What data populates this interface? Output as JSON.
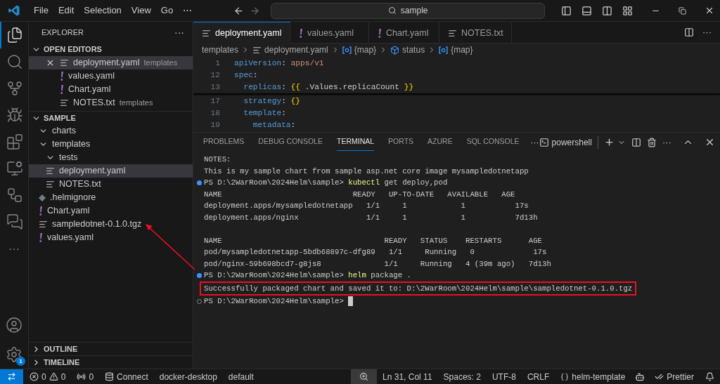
{
  "title_bar": {
    "menu": [
      "File",
      "Edit",
      "Selection",
      "View",
      "Go",
      "⋯"
    ],
    "search": "sample"
  },
  "activity_bar": {
    "items": [
      {
        "kind": "files",
        "selected": true
      },
      {
        "kind": "search",
        "selected": false
      },
      {
        "kind": "source",
        "selected": false
      },
      {
        "kind": "run",
        "selected": false
      },
      {
        "kind": "extensions",
        "selected": false
      },
      {
        "kind": "remote",
        "selected": false
      },
      {
        "kind": "workflow",
        "selected": false
      },
      {
        "kind": "chat",
        "selected": false
      }
    ],
    "more": "···",
    "settings_badge": "1"
  },
  "explorer": {
    "title": "EXPLORER",
    "more": "···",
    "open_editors": {
      "label": "OPEN EDITORS",
      "expanded": true,
      "items": [
        {
          "name": "deployment.yaml",
          "folder": "templates",
          "kind": "text",
          "selected": true
        },
        {
          "name": "values.yaml",
          "kind": "yaml",
          "selected": false
        },
        {
          "name": "Chart.yaml",
          "kind": "yaml",
          "selected": false
        },
        {
          "name": "NOTES.txt",
          "folder": "templates",
          "kind": "text",
          "selected": false
        }
      ]
    },
    "workspace": {
      "label": "SAMPLE",
      "expanded": true,
      "items": [
        {
          "name": "charts",
          "kind": "folder",
          "expanded": true,
          "selected": false
        },
        {
          "name": "templates",
          "kind": "folder",
          "expanded": true,
          "selected": false,
          "children": [
            {
              "name": "tests",
              "kind": "folder",
              "expanded": true,
              "selected": false
            },
            {
              "name": "deployment.yaml",
              "kind": "text",
              "selected": true
            },
            {
              "name": "NOTES.txt",
              "kind": "text",
              "selected": false
            }
          ]
        },
        {
          "name": ".helmignore",
          "kind": "ignore",
          "selected": false
        },
        {
          "name": "Chart.yaml",
          "kind": "yaml",
          "selected": false
        },
        {
          "name": "sampledotnet-0.1.0.tgz",
          "kind": "text",
          "selected": false
        },
        {
          "name": "values.yaml",
          "kind": "yaml",
          "selected": false
        }
      ]
    },
    "sections": [
      {
        "label": "OUTLINE",
        "expanded": false
      },
      {
        "label": "TIMELINE",
        "expanded": false
      }
    ]
  },
  "editor": {
    "tabs": [
      {
        "name": "deployment.yaml",
        "kind": "text",
        "selected": true
      },
      {
        "name": "values.yaml",
        "kind": "yaml",
        "selected": false
      },
      {
        "name": "Chart.yaml",
        "kind": "yaml",
        "selected": false
      },
      {
        "name": "NOTES.txt",
        "kind": "text",
        "selected": false
      }
    ],
    "breadcrumb": [
      {
        "text": "templates",
        "kind": "folder"
      },
      {
        "text": "deployment.yaml",
        "kind": "text"
      },
      {
        "text": "{map}",
        "kind": "map"
      },
      {
        "text": "status",
        "kind": "cube"
      },
      {
        "text": "{map}",
        "kind": "map"
      }
    ],
    "sticky_lines": [
      {
        "number": "1",
        "tokens": [
          {
            "text": "apiVersion",
            "kind": "key"
          },
          {
            "text": ": ",
            "kind": "punct"
          },
          {
            "text": "apps/v1",
            "kind": "string"
          }
        ]
      },
      {
        "number": "12",
        "tokens": [
          {
            "text": "spec",
            "kind": "key"
          },
          {
            "text": ":",
            "kind": "punct"
          }
        ]
      },
      {
        "number": "13",
        "tokens": [
          {
            "text": "  replicas",
            "kind": "key"
          },
          {
            "text": ": ",
            "kind": "punct"
          },
          {
            "text": "{{",
            "kind": "brace"
          },
          {
            "text": " .Values.replicaCount ",
            "kind": "punct"
          },
          {
            "text": "}}",
            "kind": "brace"
          }
        ]
      }
    ],
    "lines": [
      {
        "number": "17",
        "tokens": [
          {
            "text": "  strategy",
            "kind": "key"
          },
          {
            "text": ": ",
            "kind": "punct"
          },
          {
            "text": "{}",
            "kind": "brace"
          }
        ]
      },
      {
        "number": "18",
        "tokens": [
          {
            "text": "  template",
            "kind": "key"
          },
          {
            "text": ":",
            "kind": "punct"
          }
        ]
      },
      {
        "number": "19",
        "tokens": [
          {
            "text": "    metadata",
            "kind": "key"
          },
          {
            "text": ":",
            "kind": "punct"
          }
        ]
      }
    ]
  },
  "panel": {
    "tabs": [
      {
        "label": "PROBLEMS",
        "selected": false
      },
      {
        "label": "DEBUG CONSOLE",
        "selected": false
      },
      {
        "label": "TERMINAL",
        "selected": true
      },
      {
        "label": "PORTS",
        "selected": false
      },
      {
        "label": "AZURE",
        "selected": false
      },
      {
        "label": "SQL CONSOLE",
        "selected": false
      }
    ],
    "more": "···",
    "shell": "powershell",
    "terminal": [
      {
        "kind": "output",
        "text": "NOTES:"
      },
      {
        "kind": "output",
        "text": "This is my sample chart from sample asp.net core image mysampledotnetapp"
      },
      {
        "kind": "prompt",
        "succeeded": true,
        "path": "PS D:\\2WarRoom\\2024Helm\\sample> ",
        "command": "kubectl",
        "args": " get deploy,pod"
      },
      {
        "kind": "output",
        "text": "NAME                             READY   UP-TO-DATE   AVAILABLE   AGE"
      },
      {
        "kind": "output",
        "text": "deployment.apps/mysampledotnetapp   1/1     1            1           17s"
      },
      {
        "kind": "output",
        "text": "deployment.apps/nginx               1/1     1            1           7d13h"
      },
      {
        "kind": "blank"
      },
      {
        "kind": "output",
        "text": "NAME                                    READY   STATUS    RESTARTS      AGE"
      },
      {
        "kind": "output",
        "text": "pod/mysampledotnetapp-5bdb68897c-dfg89   1/1     Running   0             17s"
      },
      {
        "kind": "output",
        "text": "pod/nginx-59b698bcd7-g8js8              1/1     Running   4 (39m ago)   7d13h"
      },
      {
        "kind": "prompt",
        "succeeded": true,
        "path": "PS D:\\2WarRoom\\2024Helm\\sample> ",
        "command": "helm",
        "args": " package ."
      },
      {
        "kind": "output",
        "text": "Successfully packaged chart and saved it to: D:\\2WarRoom\\2024Helm\\sample\\sampledotnet-0.1.0.tgz",
        "highlighted": true
      },
      {
        "kind": "prompt",
        "succeeded": false,
        "path": "PS D:\\2WarRoom\\2024Helm\\sample> ",
        "cursor": true
      }
    ]
  },
  "status_bar": {
    "errors": "0",
    "warnings": "0",
    "ports": "0",
    "connect": "Connect",
    "context": "docker-desktop",
    "namespace": "default",
    "position": "Ln 31, Col 11",
    "spaces": "Spaces: 2",
    "encoding": "UTF-8",
    "eol": "CRLF",
    "language": "helm-template",
    "formatter": "Prettier"
  }
}
